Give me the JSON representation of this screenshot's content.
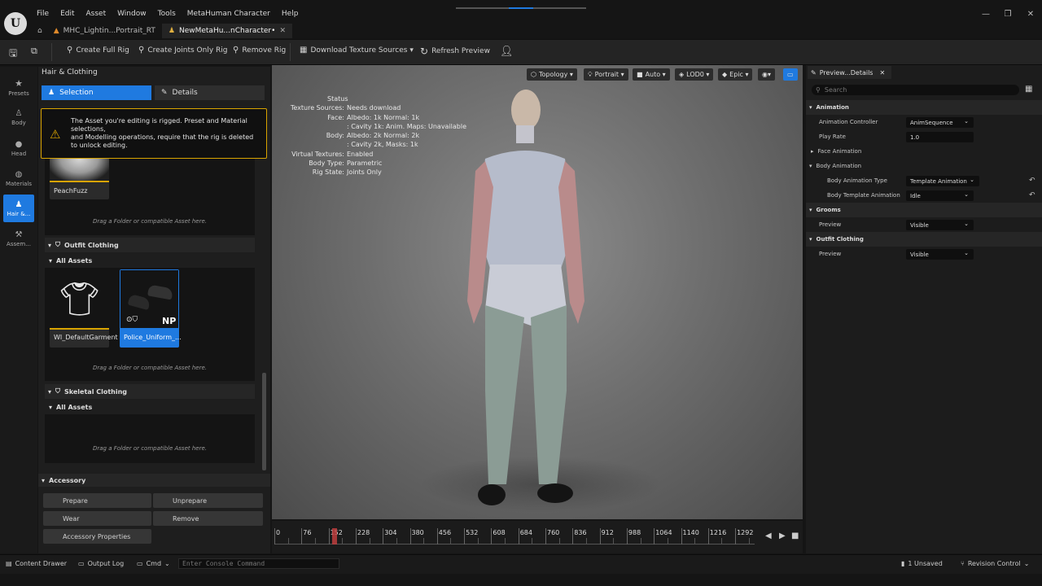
{
  "app": {
    "logo_text": "U"
  },
  "menu": [
    "File",
    "Edit",
    "Asset",
    "Window",
    "Tools",
    "MetaHuman Character",
    "Help"
  ],
  "tabs": [
    {
      "label": "MHC_Lightin...Portrait_RT",
      "icon": "lighting-asset-icon"
    },
    {
      "label": "NewMetaHu...nCharacter•",
      "icon": "metahuman-asset-icon"
    }
  ],
  "toolbar": {
    "create_full_rig": "Create Full Rig",
    "create_joints_only_rig": "Create Joints Only Rig",
    "remove_rig": "Remove Rig",
    "download_texture_sources": "Download Texture Sources ▾",
    "refresh_preview": "Refresh Preview"
  },
  "leftnav": [
    {
      "label": "Presets",
      "icon": "star-icon"
    },
    {
      "label": "Body",
      "icon": "body-icon"
    },
    {
      "label": "Head",
      "icon": "head-icon"
    },
    {
      "label": "Materials",
      "icon": "materials-icon"
    },
    {
      "label": "Hair &...",
      "icon": "hair-icon"
    },
    {
      "label": "Assem...",
      "icon": "hammer-icon"
    }
  ],
  "panel": {
    "title": "Hair & Clothing",
    "selection": "Selection",
    "details": "Details",
    "warning_lines": [
      "The Asset you're editing is rigged. Preset and Material selections,",
      "and Modelling operations, require that the rig is deleted to unlock editing."
    ],
    "peachfuzz_label": "PeachFuzz",
    "drop_hint": "Drag a Folder or compatible Asset here.",
    "outfit_section": "Outfit Clothing",
    "all_assets": "All Assets",
    "outfit_items": [
      "WI_DefaultGarment",
      "Police_Uniform_..."
    ],
    "np_badge": "NP",
    "skeletal_section": "Skeletal Clothing",
    "accessory_section": "Accessory",
    "buttons": {
      "prepare": "Prepare",
      "unprepare": "Unprepare",
      "wear": "Wear",
      "remove": "Remove",
      "accessory_properties": "Accessory Properties"
    }
  },
  "viewport": {
    "buttons": [
      "Topology ▾",
      "Portrait ▾",
      "Auto ▾",
      "LOD0 ▾",
      "Epic ▾"
    ],
    "status_title": "Status",
    "status": [
      {
        "k": "Texture Sources:",
        "v": "Needs download"
      },
      {
        "k": "Face:",
        "v": "Albedo: 1k Normal: 1k"
      },
      {
        "k": "",
        "v": ": Cavity 1k: Anim. Maps: Unavailable"
      },
      {
        "k": "Body:",
        "v": "Albedo: 2k Normal: 2k"
      },
      {
        "k": "",
        "v": ": Cavity 2k, Masks: 1k"
      },
      {
        "k": "Virtual Textures:",
        "v": "Enabled"
      },
      {
        "k": "Body Type:",
        "v": "Parametric"
      },
      {
        "k": "Rig State:",
        "v": "Joints Only"
      }
    ]
  },
  "timeline": {
    "ticks": [
      "0",
      "76",
      "152",
      "228",
      "304",
      "380",
      "456",
      "532",
      "608",
      "684",
      "760",
      "836",
      "912",
      "988",
      "1064",
      "1140",
      "1216",
      "1292"
    ],
    "current": "152"
  },
  "details": {
    "tab": "Preview...Details",
    "search_placeholder": "Search",
    "animation": "Animation",
    "animation_controller": "Animation Controller",
    "animation_controller_value": "AnimSequence",
    "play_rate": "Play Rate",
    "play_rate_value": "1.0",
    "face_animation": "Face Animation",
    "body_animation": "Body Animation",
    "body_animation_type": "Body Animation Type",
    "body_animation_type_value": "Template Animation",
    "body_template_animation": "Body Template Animation",
    "body_template_animation_value": "Idle",
    "grooms": "Grooms",
    "preview": "Preview",
    "preview_value": "Visible",
    "outfit_clothing": "Outfit Clothing"
  },
  "statusbar": {
    "content_drawer": "Content Drawer",
    "output_log": "Output Log",
    "cmd": "Cmd",
    "console_placeholder": "Enter Console Command",
    "unsaved": "1 Unsaved",
    "revision_control": "Revision Control"
  },
  "colors": {
    "accent": "#1f7ae0",
    "warning": "#d9a400",
    "playhead": "#c84040"
  }
}
